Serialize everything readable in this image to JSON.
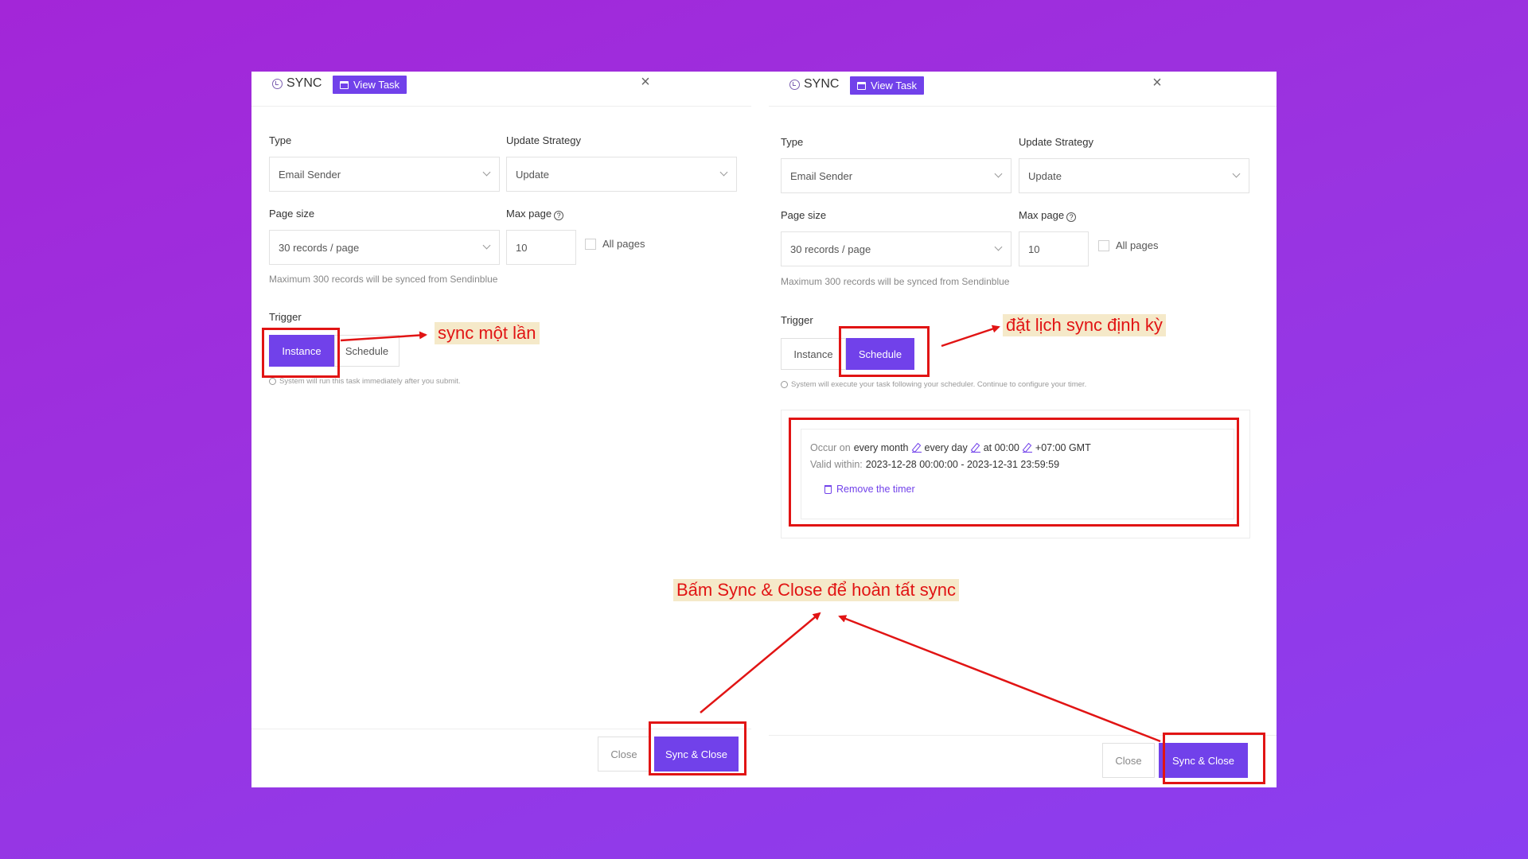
{
  "dialog_left": {
    "title": "SYNC",
    "view_task_label": "View Task",
    "close_icon": "×",
    "type_label": "Type",
    "type_value": "Email Sender",
    "strategy_label": "Update Strategy",
    "strategy_value": "Update",
    "page_size_label": "Page size",
    "page_size_value": "30 records / page",
    "max_page_label": "Max page",
    "max_page_value": "10",
    "all_pages_label": "All pages",
    "max_note": "Maximum 300 records will be synced from Sendinblue",
    "trigger_label": "Trigger",
    "trigger_options": [
      "Instance",
      "Schedule"
    ],
    "trigger_selected": "Instance",
    "trigger_hint": "System will run this task immediately after you submit.",
    "close_button": "Close",
    "sync_close_button": "Sync & Close"
  },
  "dialog_right": {
    "title": "SYNC",
    "view_task_label": "View Task",
    "close_icon": "×",
    "type_label": "Type",
    "type_value": "Email Sender",
    "strategy_label": "Update Strategy",
    "strategy_value": "Update",
    "page_size_label": "Page size",
    "page_size_value": "30 records / page",
    "max_page_label": "Max page",
    "max_page_value": "10",
    "all_pages_label": "All pages",
    "max_note": "Maximum 300 records will be synced from Sendinblue",
    "trigger_label": "Trigger",
    "trigger_options": [
      "Instance",
      "Schedule"
    ],
    "trigger_selected": "Schedule",
    "trigger_hint": "System will execute your task following your scheduler. Continue to configure your timer.",
    "timer": {
      "occur_prefix": "Occur on",
      "every_month": "every month",
      "every_day": "every day",
      "at_time": "at 00:00",
      "timezone": "+07:00 GMT",
      "valid_prefix": "Valid within:",
      "valid_range": "2023-12-28 00:00:00 - 2023-12-31 23:59:59",
      "remove_label": "Remove the timer"
    },
    "close_button": "Close",
    "sync_close_button": "Sync & Close"
  },
  "annotations": {
    "left_trigger": "sync một lần",
    "right_trigger": "đặt lịch sync định kỳ",
    "bottom": "Bấm Sync & Close để hoàn tất sync"
  },
  "colors": {
    "accent": "#7141ea",
    "annotation_red": "#e11414",
    "annotation_bg": "#f5e9c9"
  }
}
